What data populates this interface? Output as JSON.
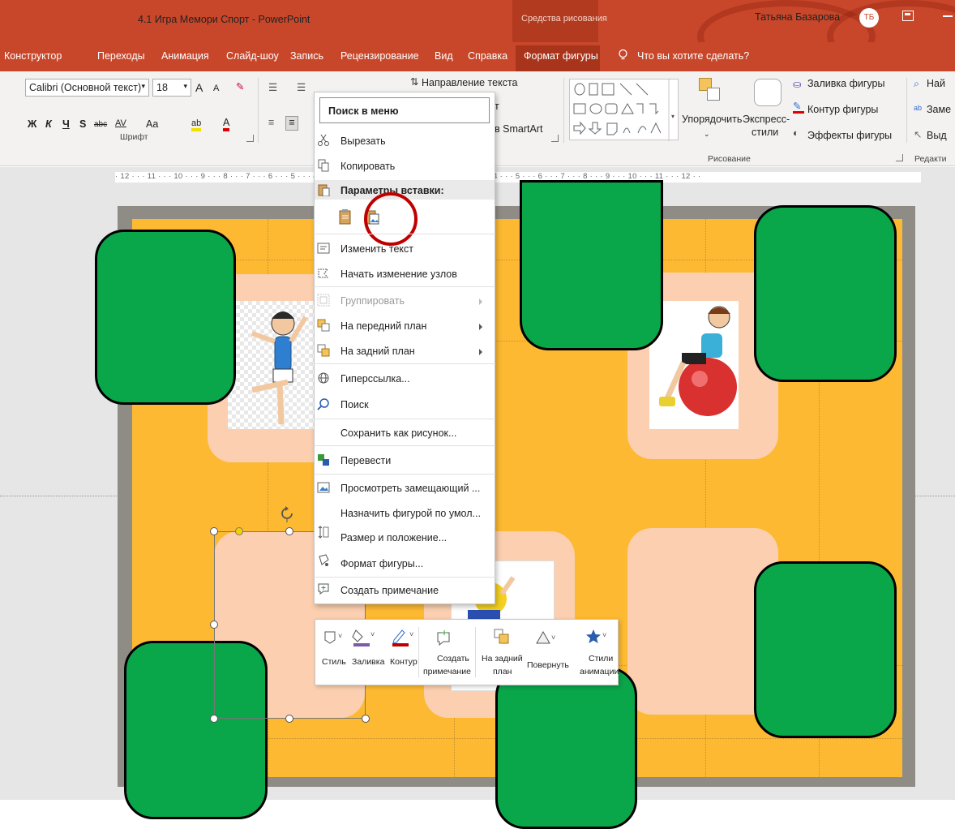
{
  "titlebar": {
    "document_title": "4.1 Игра Мемори Спорт  -  PowerPoint",
    "contextual_tools": "Средства рисования",
    "user_name": "Татьяна Базарова",
    "user_initials": "ТБ"
  },
  "tabs": [
    {
      "label": "Конструктор"
    },
    {
      "label": "Переходы"
    },
    {
      "label": "Анимация"
    },
    {
      "label": "Слайд-шоу"
    },
    {
      "label": "Запись"
    },
    {
      "label": "Рецензирование"
    },
    {
      "label": "Вид"
    },
    {
      "label": "Справка"
    },
    {
      "label": "Формат фигуры"
    }
  ],
  "tell_me": "Что вы хотите сделать?",
  "ribbon": {
    "font_name": "Calibri (Основной текст)",
    "font_size": "18",
    "grow_font": "A",
    "shrink_font": "A",
    "bold": "Ж",
    "italic": "К",
    "underline": "Ч",
    "strike": "S",
    "abc": "abc",
    "spacing": "AV",
    "case": "Aa",
    "highlight": "ab",
    "font_color": "A",
    "font_group_label": "Шрифт",
    "text_direction": "Направление текста",
    "align_text_partial": "т",
    "smartart_partial": "в SmartArt",
    "arrange": "Упорядочить",
    "quick_styles_1": "Экспресс-",
    "quick_styles_2": "стили",
    "shape_fill": "Заливка фигуры",
    "shape_outline": "Контур фигуры",
    "shape_effects": "Эффекты фигуры",
    "drawing_group_label": "Рисование",
    "find_partial": "Най",
    "replace_partial": "Заме",
    "select_partial": "Выд",
    "editing_group_label": "Редакти"
  },
  "ruler_text": "· 12 · · · 11 · · · 10 · · · 9 · · · 8 · · · 7 · · · 6 · · · 5 · · · 4 · · · 3 · · · 2 · · · 1 · · · 0 · · · 1 · · · 2 · · · 3 · · · 4 · · · 5 · · · 6 · · · 7 · · · 8 · · · 9 · · · 10 · · · 11 · · · 12 · ·",
  "context_menu": {
    "search_label": "Поиск в меню",
    "items": [
      {
        "label": "Вырезать",
        "enabled": true
      },
      {
        "label": "Копировать",
        "enabled": true
      },
      {
        "label": "Параметры вставки:",
        "enabled": true
      },
      {
        "label": "Изменить текст",
        "enabled": true
      },
      {
        "label": "Начать изменение узлов",
        "enabled": true
      },
      {
        "label": "Группировать",
        "enabled": false
      },
      {
        "label": "На передний план",
        "enabled": true
      },
      {
        "label": "На задний план",
        "enabled": true
      },
      {
        "label": "Гиперссылка...",
        "enabled": true
      },
      {
        "label": "Поиск",
        "enabled": true
      },
      {
        "label": "Сохранить как рисунок...",
        "enabled": true
      },
      {
        "label": "Перевести",
        "enabled": true
      },
      {
        "label": "Просмотреть замещающий ...",
        "enabled": true
      },
      {
        "label": "Назначить фигурой по умол...",
        "enabled": true
      },
      {
        "label": "Размер и положение...",
        "enabled": true
      },
      {
        "label": "Формат фигуры...",
        "enabled": true
      },
      {
        "label": "Создать примечание",
        "enabled": true
      }
    ]
  },
  "mini_toolbar": {
    "style": "Стиль",
    "fill": "Заливка",
    "outline": "Контур",
    "new_comment_1": "Создать",
    "new_comment_2": "примечание",
    "send_back_1": "На задний",
    "send_back_2": "план",
    "rotate": "Повернуть",
    "anim_1": "Стили",
    "anim_2": "анимации"
  },
  "colors": {
    "accent": "#c8472a",
    "card_green": "#0aa64a",
    "slide_orange": "#fdb932",
    "pad_peach": "#fbcfaf",
    "annotation_red": "#c00000"
  }
}
